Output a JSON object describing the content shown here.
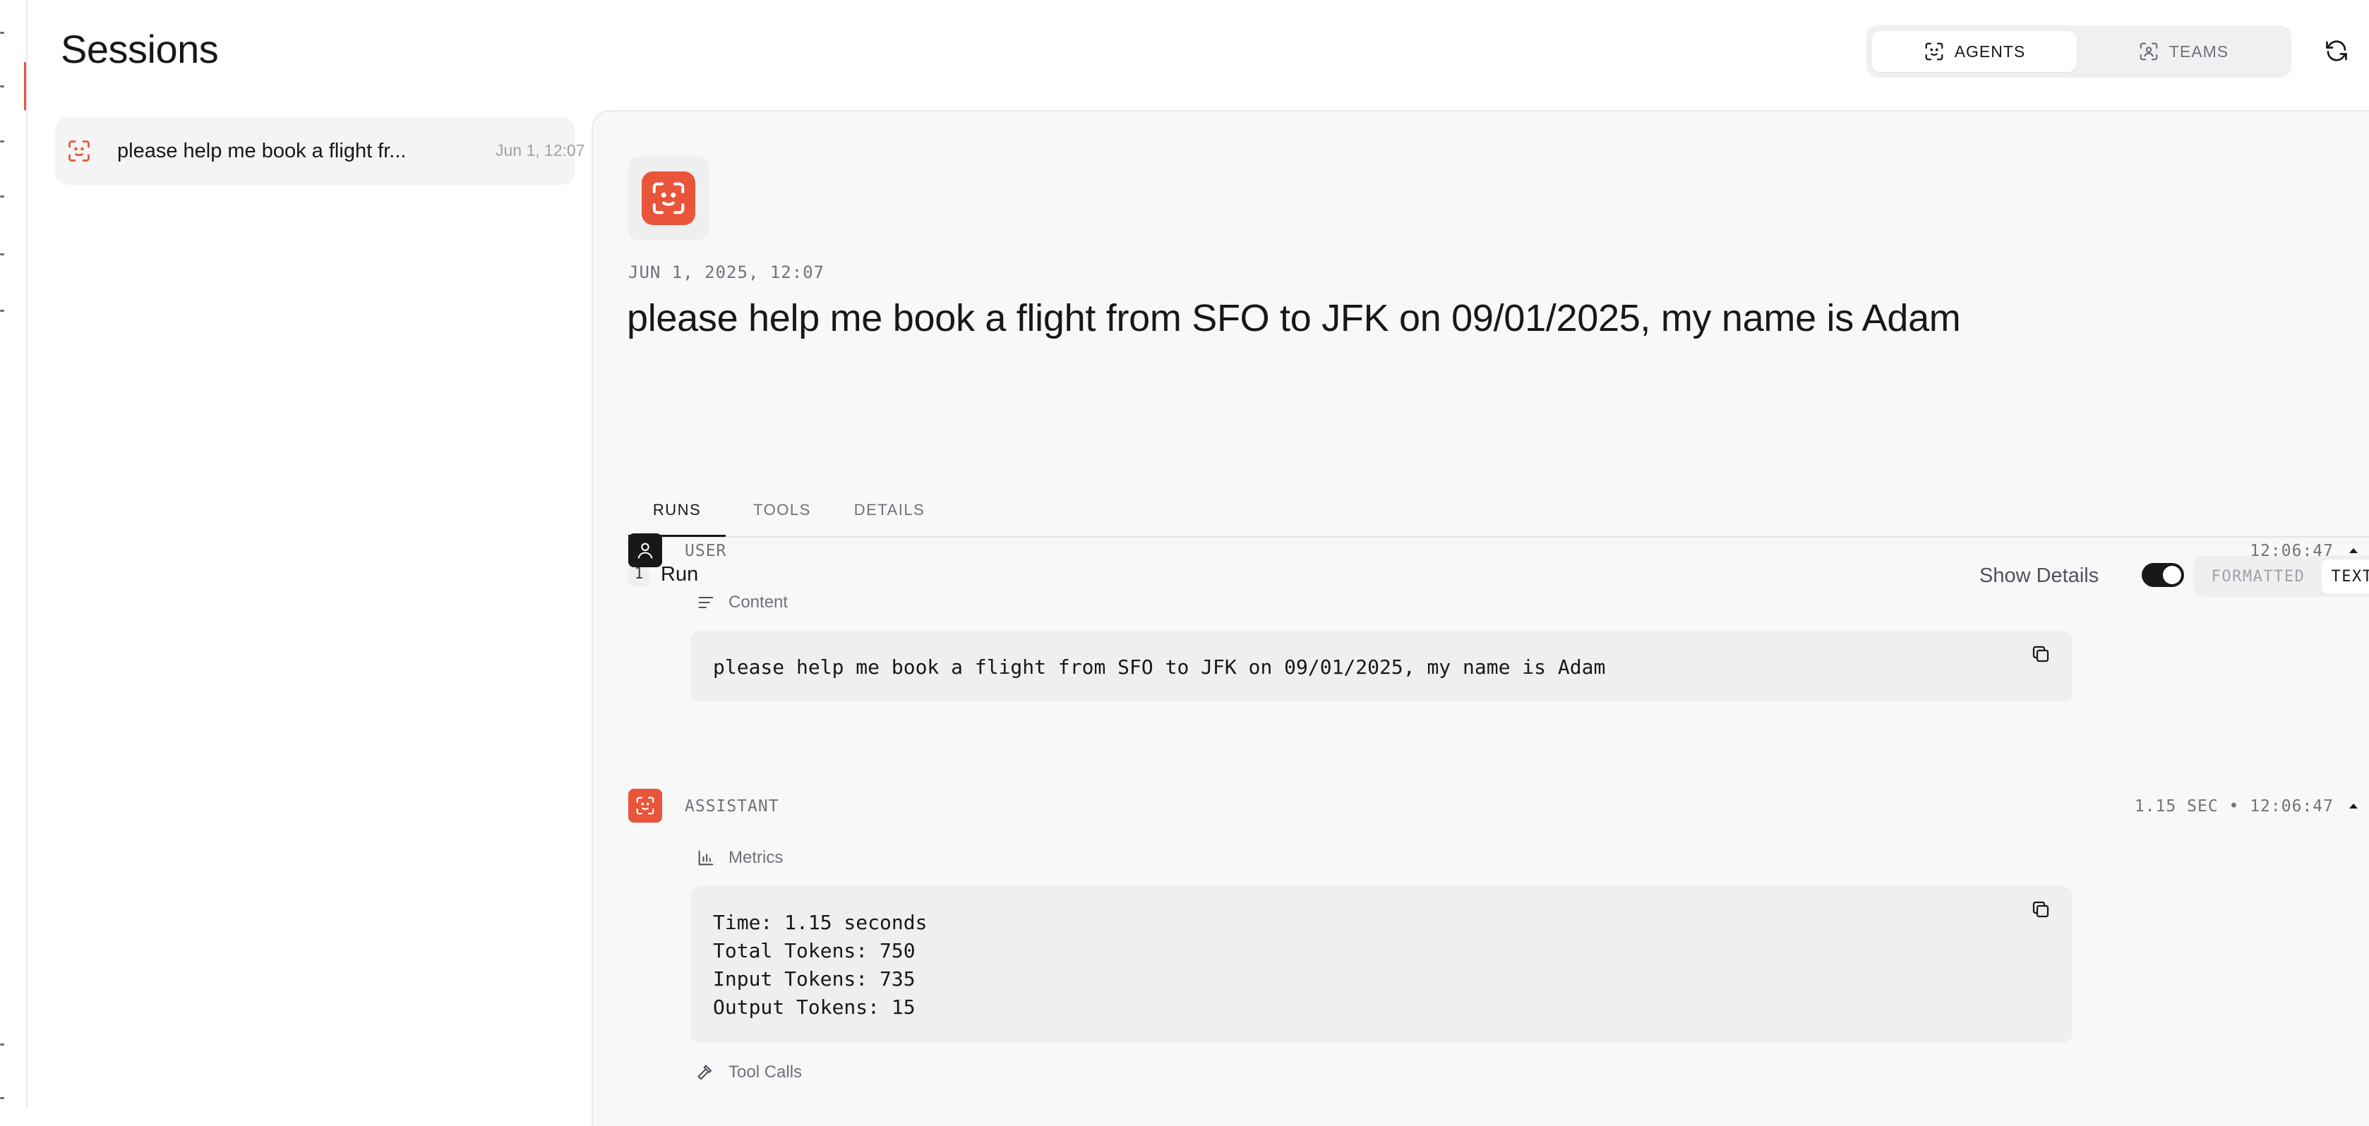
{
  "header": {
    "title": "Sessions",
    "mode_tabs": [
      {
        "label": "AGENTS",
        "active": true
      },
      {
        "label": "TEAMS",
        "active": false
      }
    ],
    "refresh_icon": "refresh-icon"
  },
  "sessions": [
    {
      "title": "please help me book a flight fr...",
      "date": "Jun 1, 12:07",
      "icon": "agent-icon"
    }
  ],
  "session_detail": {
    "date": "JUN 1, 2025, 12:07",
    "title": "please help me book a flight from SFO to JFK on 09/01/2025, my name is Adam",
    "tabs": [
      {
        "label": "RUNS",
        "active": true
      },
      {
        "label": "TOOLS",
        "active": false
      },
      {
        "label": "DETAILS",
        "active": false
      }
    ],
    "run": {
      "number": "1",
      "label": "Run",
      "show_details_label": "Show Details",
      "show_details_on": true,
      "view_modes": [
        {
          "label": "FORMATTED",
          "active": false
        },
        {
          "label": "TEXT",
          "active": true
        }
      ]
    },
    "user_message": {
      "role": "USER",
      "time": "12:06:47",
      "section_label": "Content",
      "content": "please help me book a flight from SFO to JFK on 09/01/2025, my name is Adam"
    },
    "assistant_message": {
      "role": "ASSISTANT",
      "time": "1.15 SEC • 12:06:47",
      "metrics_label": "Metrics",
      "metrics": [
        "Time: 1.15 seconds",
        "Total Tokens: 750",
        "Input Tokens: 735",
        "Output Tokens: 15"
      ],
      "tool_calls_label": "Tool Calls"
    }
  },
  "colors": {
    "accent": "#e8553a",
    "text": "#18181b",
    "muted": "#71717a",
    "panel": "#f8f8f9"
  }
}
